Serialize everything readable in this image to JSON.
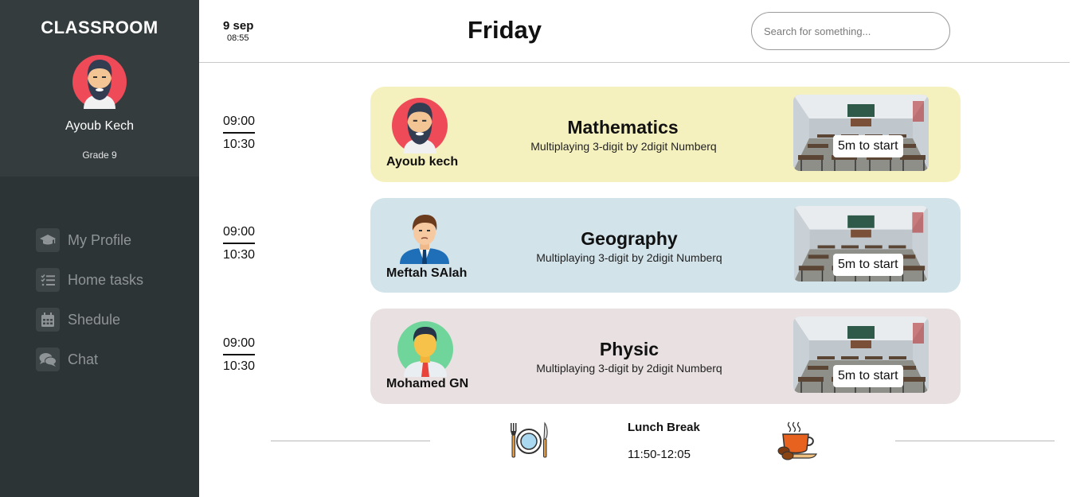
{
  "sidebar": {
    "brand": "CLASSROOM",
    "user": {
      "name": "Ayoub Kech",
      "grade": "Grade 9"
    },
    "items": [
      {
        "label": "My Profile",
        "icon": "graduation-cap-icon"
      },
      {
        "label": "Home tasks",
        "icon": "task-list-icon"
      },
      {
        "label": "Shedule",
        "icon": "calendar-icon"
      },
      {
        "label": "Chat",
        "icon": "chat-bubbles-icon"
      }
    ]
  },
  "header": {
    "date": "9 sep",
    "time": "08:55",
    "day": "Friday",
    "search_placeholder": "Search for something..."
  },
  "lessons": [
    {
      "start": "09:00",
      "end": "10:30",
      "subject": "Mathematics",
      "description": "Multiplaying 3-digit by 2digit Numberq",
      "teacher": "Ayoub kech",
      "status": "5m to start",
      "color": "#f5f1bf"
    },
    {
      "start": "09:00",
      "end": "10:30",
      "subject": "Geography",
      "description": "Multiplaying 3-digit by 2digit Numberq",
      "teacher": "Meftah SAlah",
      "status": "5m to start",
      "color": "#d2e3ea"
    },
    {
      "start": "09:00",
      "end": "10:30",
      "subject": "Physic",
      "description": "Multiplaying 3-digit by 2digit Numberq",
      "teacher": "Mohamed GN",
      "status": "5m to start",
      "color": "#e9e1e1"
    }
  ],
  "break": {
    "title": "Lunch Break",
    "time": "11:50-12:05"
  },
  "colors": {
    "sidebar": "#2d3436",
    "sidebar_top": "#343c3e",
    "avatar_red": "#ee4a57",
    "avatar_green": "#6fd59b"
  }
}
